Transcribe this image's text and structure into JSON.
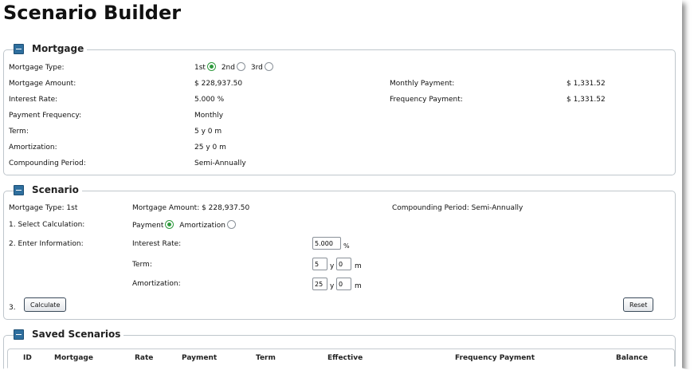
{
  "page_title": "Scenario Builder",
  "mortgage": {
    "legend": "Mortgage",
    "type_label": "Mortgage Type:",
    "type_options": [
      {
        "label": "1st",
        "checked": true
      },
      {
        "label": "2nd",
        "checked": false
      },
      {
        "label": "3rd",
        "checked": false
      }
    ],
    "amount_label": "Mortgage Amount:",
    "amount_value": "$ 228,937.50",
    "rate_label": "Interest Rate:",
    "rate_value": "5.000 %",
    "frequency_label": "Payment Frequency:",
    "frequency_value": "Monthly",
    "term_label": "Term:",
    "term_value": "5 y 0 m",
    "amortization_label": "Amortization:",
    "amortization_value": "25 y 0 m",
    "compounding_label": "Compounding Period:",
    "compounding_value": "Semi-Annually",
    "monthly_payment_label": "Monthly Payment:",
    "monthly_payment_value": "$ 1,331.52",
    "frequency_payment_label": "Frequency Payment:",
    "frequency_payment_value": "$ 1,331.52"
  },
  "scenario": {
    "legend": "Scenario",
    "type_text": "Mortgage Type: 1st",
    "amount_text": "Mortgage Amount: $ 228,937.50",
    "compounding_text": "Compounding Period: Semi-Annually",
    "step1_label": "1. Select Calculation:",
    "calc_options": [
      {
        "label": "Payment",
        "checked": true
      },
      {
        "label": "Amortization",
        "checked": false
      }
    ],
    "step2_label": "2. Enter Information:",
    "rate_label": "Interest Rate:",
    "rate_value": "5.000",
    "rate_unit": "%",
    "term_label": "Term:",
    "term_years": "5",
    "term_months": "0",
    "amortization_label": "Amortization:",
    "amort_years": "25",
    "amort_months": "0",
    "unit_years": "y",
    "unit_months": "m",
    "step3_label": "3.",
    "calculate_label": "Calculate",
    "reset_label": "Reset"
  },
  "saved": {
    "legend": "Saved Scenarios",
    "columns": [
      "ID",
      "Mortgage",
      "Rate",
      "Payment",
      "Term",
      "Effective",
      "Frequency Payment",
      "Balance"
    ]
  },
  "colors": {
    "toggle": "#2f6f9e",
    "radio_checked": "#2f9a3e",
    "border": "#bfc6cc"
  }
}
